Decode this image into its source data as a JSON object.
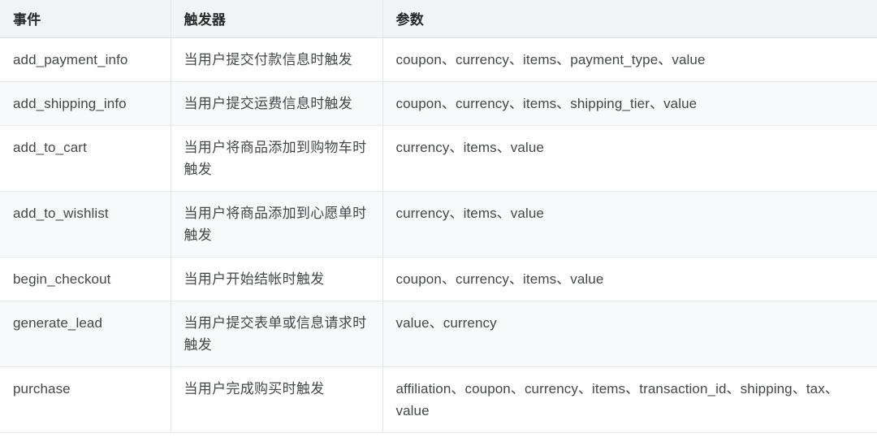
{
  "table": {
    "columns": [
      {
        "key": "event",
        "label": "事件"
      },
      {
        "key": "trigger",
        "label": "触发器"
      },
      {
        "key": "params",
        "label": "参数"
      }
    ],
    "rows": [
      {
        "event": "add_payment_info",
        "trigger": "当用户提交付款信息时触发",
        "params": "coupon、currency、items、payment_type、value"
      },
      {
        "event": "add_shipping_info",
        "trigger": "当用户提交运费信息时触发",
        "params": "coupon、currency、items、shipping_tier、value"
      },
      {
        "event": "add_to_cart",
        "trigger": "当用户将商品添加到购物车时触发",
        "params": "currency、items、value"
      },
      {
        "event": "add_to_wishlist",
        "trigger": "当用户将商品添加到心愿单时触发",
        "params": "currency、items、value"
      },
      {
        "event": "begin_checkout",
        "trigger": "当用户开始结帐时触发",
        "params": "coupon、currency、items、value"
      },
      {
        "event": "generate_lead",
        "trigger": "当用户提交表单或信息请求时触发",
        "params": "value、currency"
      },
      {
        "event": "purchase",
        "trigger": "当用户完成购买时触发",
        "params": "affiliation、coupon、currency、items、transaction_id、shipping、tax、value"
      }
    ]
  },
  "colors": {
    "header_background": "#f1f3f4",
    "row_stripe": "#f7f9fa",
    "row_base": "#ffffff",
    "text": "#44474a",
    "header_text": "#26282b",
    "border": "#e4e7ea"
  }
}
